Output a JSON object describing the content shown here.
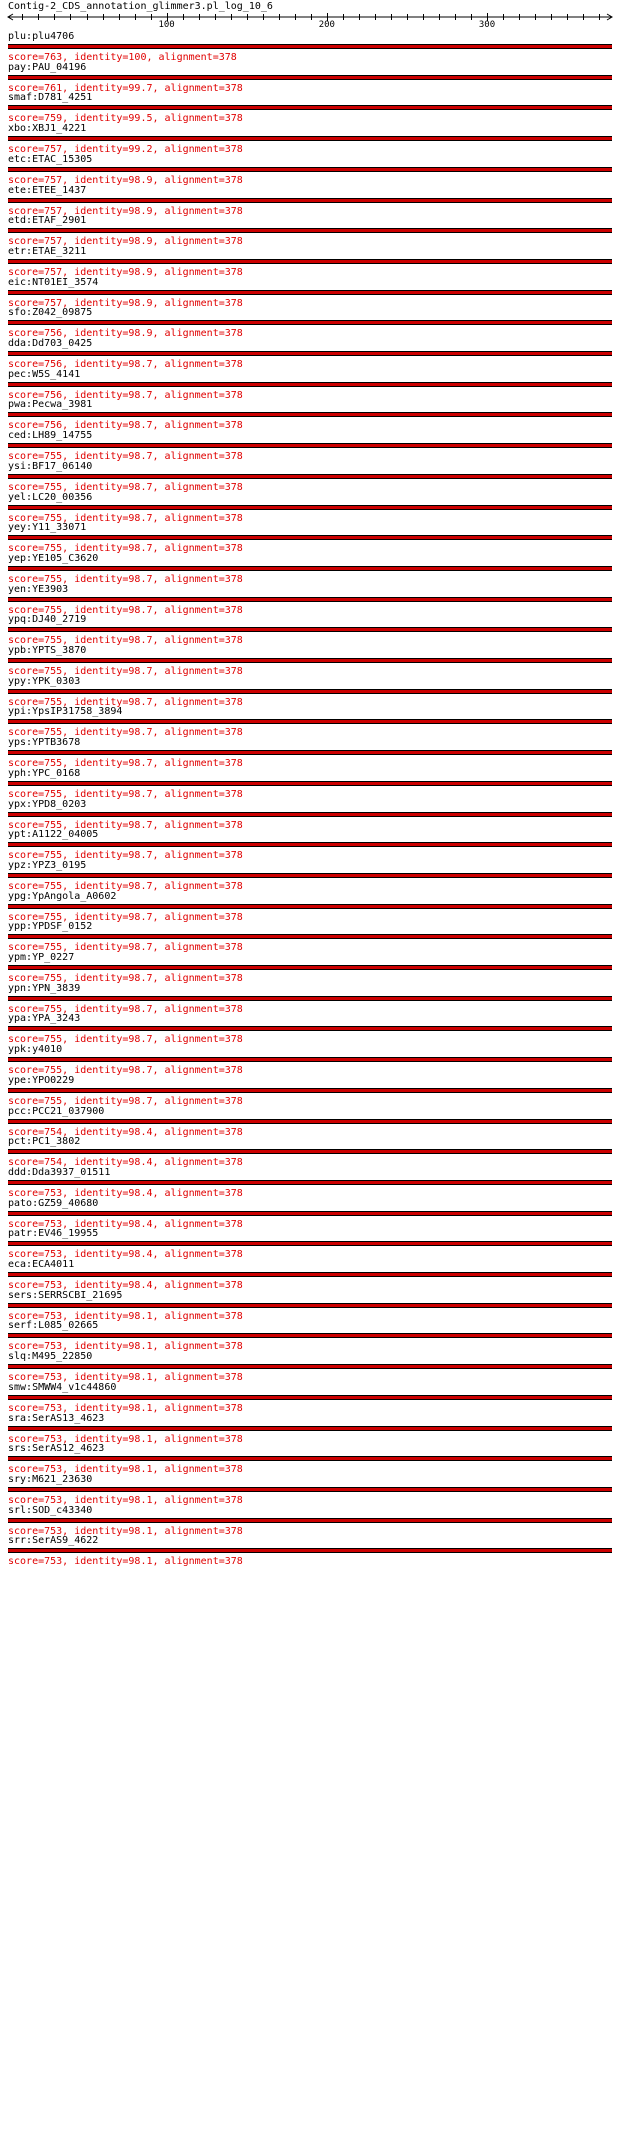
{
  "title": "Contig-2_CDS_annotation_glimmer3.pl_log_10_6",
  "ruler": {
    "min": 1,
    "max": 378,
    "major_ticks": [
      100,
      200,
      300
    ]
  },
  "colors": {
    "bar": "#cc0000",
    "score_text": "#e00000",
    "outline": "#000000"
  },
  "hits": [
    {
      "name": "plu:plu4706",
      "score": "score=763, identity=100, alignment=378"
    },
    {
      "name": "pay:PAU_04196",
      "score": "score=761, identity=99.7, alignment=378"
    },
    {
      "name": "smaf:D781_4251",
      "score": "score=759, identity=99.5, alignment=378"
    },
    {
      "name": "xbo:XBJ1_4221",
      "score": "score=757, identity=99.2, alignment=378"
    },
    {
      "name": "etc:ETAC_15305",
      "score": "score=757, identity=98.9, alignment=378"
    },
    {
      "name": "ete:ETEE_1437",
      "score": "score=757, identity=98.9, alignment=378"
    },
    {
      "name": "etd:ETAF_2901",
      "score": "score=757, identity=98.9, alignment=378"
    },
    {
      "name": "etr:ETAE_3211",
      "score": "score=757, identity=98.9, alignment=378"
    },
    {
      "name": "eic:NT01EI_3574",
      "score": "score=757, identity=98.9, alignment=378"
    },
    {
      "name": "sfo:Z042_09875",
      "score": "score=756, identity=98.9, alignment=378"
    },
    {
      "name": "dda:Dd703_0425",
      "score": "score=756, identity=98.7, alignment=378"
    },
    {
      "name": "pec:W5S_4141",
      "score": "score=756, identity=98.7, alignment=378"
    },
    {
      "name": "pwa:Pecwa_3981",
      "score": "score=756, identity=98.7, alignment=378"
    },
    {
      "name": "ced:LH89_14755",
      "score": "score=755, identity=98.7, alignment=378"
    },
    {
      "name": "ysi:BF17_06140",
      "score": "score=755, identity=98.7, alignment=378"
    },
    {
      "name": "yel:LC20_00356",
      "score": "score=755, identity=98.7, alignment=378"
    },
    {
      "name": "yey:Y11_33071",
      "score": "score=755, identity=98.7, alignment=378"
    },
    {
      "name": "yep:YE105_C3620",
      "score": "score=755, identity=98.7, alignment=378"
    },
    {
      "name": "yen:YE3903",
      "score": "score=755, identity=98.7, alignment=378"
    },
    {
      "name": "ypq:DJ40_2719",
      "score": "score=755, identity=98.7, alignment=378"
    },
    {
      "name": "ypb:YPTS_3870",
      "score": "score=755, identity=98.7, alignment=378"
    },
    {
      "name": "ypy:YPK_0303",
      "score": "score=755, identity=98.7, alignment=378"
    },
    {
      "name": "ypi:YpsIP31758_3894",
      "score": "score=755, identity=98.7, alignment=378"
    },
    {
      "name": "yps:YPTB3678",
      "score": "score=755, identity=98.7, alignment=378"
    },
    {
      "name": "yph:YPC_0168",
      "score": "score=755, identity=98.7, alignment=378"
    },
    {
      "name": "ypx:YPD8_0203",
      "score": "score=755, identity=98.7, alignment=378"
    },
    {
      "name": "ypt:A1122_04005",
      "score": "score=755, identity=98.7, alignment=378"
    },
    {
      "name": "ypz:YPZ3_0195",
      "score": "score=755, identity=98.7, alignment=378"
    },
    {
      "name": "ypg:YpAngola_A0602",
      "score": "score=755, identity=98.7, alignment=378"
    },
    {
      "name": "ypp:YPDSF_0152",
      "score": "score=755, identity=98.7, alignment=378"
    },
    {
      "name": "ypm:YP_0227",
      "score": "score=755, identity=98.7, alignment=378"
    },
    {
      "name": "ypn:YPN_3839",
      "score": "score=755, identity=98.7, alignment=378"
    },
    {
      "name": "ypa:YPA_3243",
      "score": "score=755, identity=98.7, alignment=378"
    },
    {
      "name": "ypk:y4010",
      "score": "score=755, identity=98.7, alignment=378"
    },
    {
      "name": "ype:YPO0229",
      "score": "score=755, identity=98.7, alignment=378"
    },
    {
      "name": "pcc:PCC21_037900",
      "score": "score=754, identity=98.4, alignment=378"
    },
    {
      "name": "pct:PC1_3802",
      "score": "score=754, identity=98.4, alignment=378"
    },
    {
      "name": "ddd:Dda3937_01511",
      "score": "score=753, identity=98.4, alignment=378"
    },
    {
      "name": "pato:GZ59_40680",
      "score": "score=753, identity=98.4, alignment=378"
    },
    {
      "name": "patr:EV46_19955",
      "score": "score=753, identity=98.4, alignment=378"
    },
    {
      "name": "eca:ECA4011",
      "score": "score=753, identity=98.4, alignment=378"
    },
    {
      "name": "sers:SERRSCBI_21695",
      "score": "score=753, identity=98.1, alignment=378"
    },
    {
      "name": "serf:L085_02665",
      "score": "score=753, identity=98.1, alignment=378"
    },
    {
      "name": "slq:M495_22850",
      "score": "score=753, identity=98.1, alignment=378"
    },
    {
      "name": "smw:SMWW4_v1c44860",
      "score": "score=753, identity=98.1, alignment=378"
    },
    {
      "name": "sra:SerAS13_4623",
      "score": "score=753, identity=98.1, alignment=378"
    },
    {
      "name": "srs:SerAS12_4623",
      "score": "score=753, identity=98.1, alignment=378"
    },
    {
      "name": "sry:M621_23630",
      "score": "score=753, identity=98.1, alignment=378"
    },
    {
      "name": "srl:SOD_c43340",
      "score": "score=753, identity=98.1, alignment=378"
    },
    {
      "name": "srr:SerAS9_4622",
      "score": "score=753, identity=98.1, alignment=378"
    }
  ]
}
